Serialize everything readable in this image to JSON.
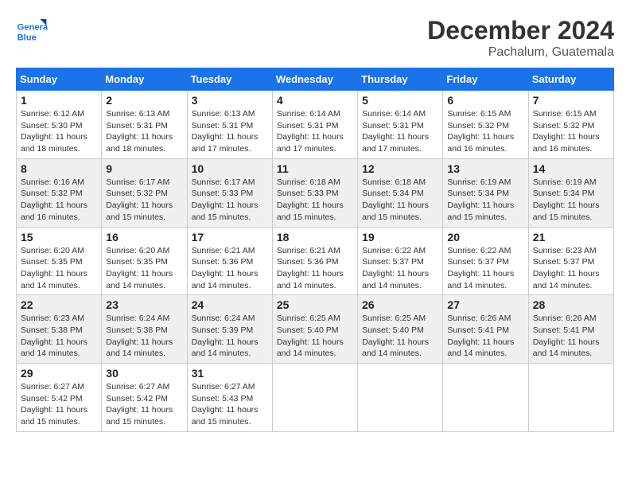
{
  "header": {
    "logo_line1": "General",
    "logo_line2": "Blue",
    "month": "December 2024",
    "location": "Pachalum, Guatemala"
  },
  "weekdays": [
    "Sunday",
    "Monday",
    "Tuesday",
    "Wednesday",
    "Thursday",
    "Friday",
    "Saturday"
  ],
  "weeks": [
    [
      {
        "day": "1",
        "sunrise": "Sunrise: 6:12 AM",
        "sunset": "Sunset: 5:30 PM",
        "daylight": "Daylight: 11 hours and 18 minutes."
      },
      {
        "day": "2",
        "sunrise": "Sunrise: 6:13 AM",
        "sunset": "Sunset: 5:31 PM",
        "daylight": "Daylight: 11 hours and 18 minutes."
      },
      {
        "day": "3",
        "sunrise": "Sunrise: 6:13 AM",
        "sunset": "Sunset: 5:31 PM",
        "daylight": "Daylight: 11 hours and 17 minutes."
      },
      {
        "day": "4",
        "sunrise": "Sunrise: 6:14 AM",
        "sunset": "Sunset: 5:31 PM",
        "daylight": "Daylight: 11 hours and 17 minutes."
      },
      {
        "day": "5",
        "sunrise": "Sunrise: 6:14 AM",
        "sunset": "Sunset: 5:31 PM",
        "daylight": "Daylight: 11 hours and 17 minutes."
      },
      {
        "day": "6",
        "sunrise": "Sunrise: 6:15 AM",
        "sunset": "Sunset: 5:32 PM",
        "daylight": "Daylight: 11 hours and 16 minutes."
      },
      {
        "day": "7",
        "sunrise": "Sunrise: 6:15 AM",
        "sunset": "Sunset: 5:32 PM",
        "daylight": "Daylight: 11 hours and 16 minutes."
      }
    ],
    [
      {
        "day": "8",
        "sunrise": "Sunrise: 6:16 AM",
        "sunset": "Sunset: 5:32 PM",
        "daylight": "Daylight: 11 hours and 16 minutes."
      },
      {
        "day": "9",
        "sunrise": "Sunrise: 6:17 AM",
        "sunset": "Sunset: 5:32 PM",
        "daylight": "Daylight: 11 hours and 15 minutes."
      },
      {
        "day": "10",
        "sunrise": "Sunrise: 6:17 AM",
        "sunset": "Sunset: 5:33 PM",
        "daylight": "Daylight: 11 hours and 15 minutes."
      },
      {
        "day": "11",
        "sunrise": "Sunrise: 6:18 AM",
        "sunset": "Sunset: 5:33 PM",
        "daylight": "Daylight: 11 hours and 15 minutes."
      },
      {
        "day": "12",
        "sunrise": "Sunrise: 6:18 AM",
        "sunset": "Sunset: 5:34 PM",
        "daylight": "Daylight: 11 hours and 15 minutes."
      },
      {
        "day": "13",
        "sunrise": "Sunrise: 6:19 AM",
        "sunset": "Sunset: 5:34 PM",
        "daylight": "Daylight: 11 hours and 15 minutes."
      },
      {
        "day": "14",
        "sunrise": "Sunrise: 6:19 AM",
        "sunset": "Sunset: 5:34 PM",
        "daylight": "Daylight: 11 hours and 15 minutes."
      }
    ],
    [
      {
        "day": "15",
        "sunrise": "Sunrise: 6:20 AM",
        "sunset": "Sunset: 5:35 PM",
        "daylight": "Daylight: 11 hours and 14 minutes."
      },
      {
        "day": "16",
        "sunrise": "Sunrise: 6:20 AM",
        "sunset": "Sunset: 5:35 PM",
        "daylight": "Daylight: 11 hours and 14 minutes."
      },
      {
        "day": "17",
        "sunrise": "Sunrise: 6:21 AM",
        "sunset": "Sunset: 5:36 PM",
        "daylight": "Daylight: 11 hours and 14 minutes."
      },
      {
        "day": "18",
        "sunrise": "Sunrise: 6:21 AM",
        "sunset": "Sunset: 5:36 PM",
        "daylight": "Daylight: 11 hours and 14 minutes."
      },
      {
        "day": "19",
        "sunrise": "Sunrise: 6:22 AM",
        "sunset": "Sunset: 5:37 PM",
        "daylight": "Daylight: 11 hours and 14 minutes."
      },
      {
        "day": "20",
        "sunrise": "Sunrise: 6:22 AM",
        "sunset": "Sunset: 5:37 PM",
        "daylight": "Daylight: 11 hours and 14 minutes."
      },
      {
        "day": "21",
        "sunrise": "Sunrise: 6:23 AM",
        "sunset": "Sunset: 5:37 PM",
        "daylight": "Daylight: 11 hours and 14 minutes."
      }
    ],
    [
      {
        "day": "22",
        "sunrise": "Sunrise: 6:23 AM",
        "sunset": "Sunset: 5:38 PM",
        "daylight": "Daylight: 11 hours and 14 minutes."
      },
      {
        "day": "23",
        "sunrise": "Sunrise: 6:24 AM",
        "sunset": "Sunset: 5:38 PM",
        "daylight": "Daylight: 11 hours and 14 minutes."
      },
      {
        "day": "24",
        "sunrise": "Sunrise: 6:24 AM",
        "sunset": "Sunset: 5:39 PM",
        "daylight": "Daylight: 11 hours and 14 minutes."
      },
      {
        "day": "25",
        "sunrise": "Sunrise: 6:25 AM",
        "sunset": "Sunset: 5:40 PM",
        "daylight": "Daylight: 11 hours and 14 minutes."
      },
      {
        "day": "26",
        "sunrise": "Sunrise: 6:25 AM",
        "sunset": "Sunset: 5:40 PM",
        "daylight": "Daylight: 11 hours and 14 minutes."
      },
      {
        "day": "27",
        "sunrise": "Sunrise: 6:26 AM",
        "sunset": "Sunset: 5:41 PM",
        "daylight": "Daylight: 11 hours and 14 minutes."
      },
      {
        "day": "28",
        "sunrise": "Sunrise: 6:26 AM",
        "sunset": "Sunset: 5:41 PM",
        "daylight": "Daylight: 11 hours and 14 minutes."
      }
    ],
    [
      {
        "day": "29",
        "sunrise": "Sunrise: 6:27 AM",
        "sunset": "Sunset: 5:42 PM",
        "daylight": "Daylight: 11 hours and 15 minutes."
      },
      {
        "day": "30",
        "sunrise": "Sunrise: 6:27 AM",
        "sunset": "Sunset: 5:42 PM",
        "daylight": "Daylight: 11 hours and 15 minutes."
      },
      {
        "day": "31",
        "sunrise": "Sunrise: 6:27 AM",
        "sunset": "Sunset: 5:43 PM",
        "daylight": "Daylight: 11 hours and 15 minutes."
      },
      null,
      null,
      null,
      null
    ]
  ]
}
